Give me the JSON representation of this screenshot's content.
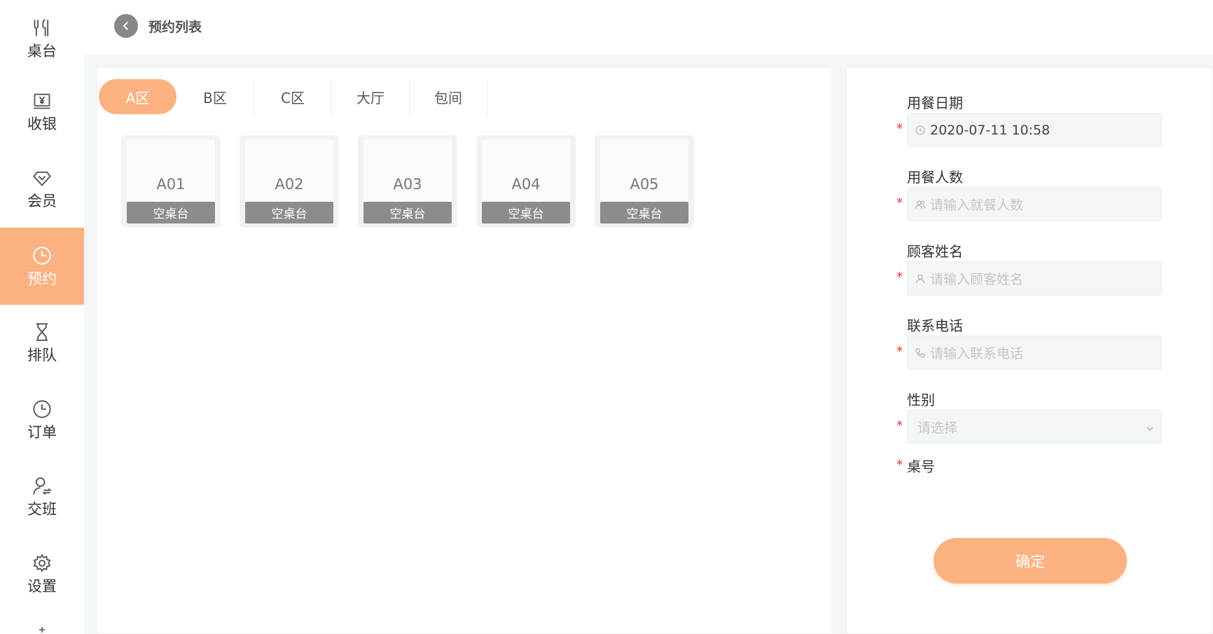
{
  "sidebar": {
    "items": [
      {
        "label": "桌台",
        "icon": "utensils-icon"
      },
      {
        "label": "收银",
        "icon": "yen-icon"
      },
      {
        "label": "会员",
        "icon": "diamond-icon"
      },
      {
        "label": "预约",
        "icon": "clock-icon"
      },
      {
        "label": "排队",
        "icon": "hourglass-icon"
      },
      {
        "label": "订单",
        "icon": "clock-icon"
      },
      {
        "label": "交班",
        "icon": "user-switch-icon"
      },
      {
        "label": "设置",
        "icon": "gear-icon"
      }
    ],
    "active_index": 3
  },
  "header": {
    "title": "预约列表"
  },
  "tabs": [
    {
      "label": "A区"
    },
    {
      "label": "B区"
    },
    {
      "label": "C区"
    },
    {
      "label": "大厅"
    },
    {
      "label": "包间"
    }
  ],
  "tables": [
    {
      "name": "A01",
      "status": "空桌台"
    },
    {
      "name": "A02",
      "status": "空桌台"
    },
    {
      "name": "A03",
      "status": "空桌台"
    },
    {
      "name": "A04",
      "status": "空桌台"
    },
    {
      "name": "A05",
      "status": "空桌台"
    }
  ],
  "form": {
    "required_mark": "*",
    "date": {
      "label": "用餐日期",
      "value": "2020-07-11 10:58"
    },
    "people": {
      "label": "用餐人数",
      "placeholder": "请输入就餐人数"
    },
    "name": {
      "label": "顾客姓名",
      "placeholder": "请输入顾客姓名"
    },
    "phone": {
      "label": "联系电话",
      "placeholder": "请输入联系电话"
    },
    "gender": {
      "label": "性别",
      "placeholder": "请选择"
    },
    "table_no": {
      "label": "桌号"
    },
    "confirm_label": "确定"
  },
  "colors": {
    "accent": "#fcb181",
    "required": "#ee3333",
    "status_bg": "#8c8c8c"
  }
}
